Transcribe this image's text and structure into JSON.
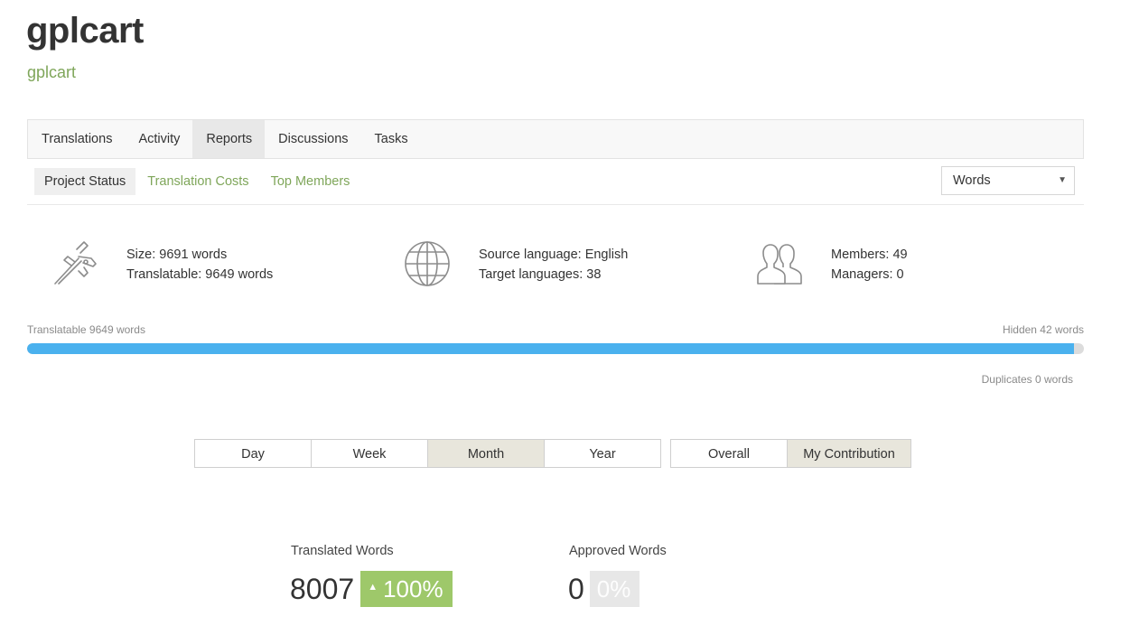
{
  "header": {
    "title": "gplcart",
    "subtitle": "gplcart"
  },
  "main_nav": [
    {
      "label": "Translations",
      "active": false
    },
    {
      "label": "Activity",
      "active": false
    },
    {
      "label": "Reports",
      "active": true
    },
    {
      "label": "Discussions",
      "active": false
    },
    {
      "label": "Tasks",
      "active": false
    }
  ],
  "sub_nav": [
    {
      "label": "Project Status",
      "active": true
    },
    {
      "label": "Translation Costs",
      "active": false
    },
    {
      "label": "Top Members",
      "active": false
    }
  ],
  "unit_select": {
    "value": "Words"
  },
  "stats": {
    "size": {
      "icon": "caliper-icon",
      "line1": "Size: 9691 words",
      "line2": "Translatable: 9649 words"
    },
    "languages": {
      "icon": "globe-icon",
      "line1": "Source language: English",
      "line2": "Target languages: 38"
    },
    "members": {
      "icon": "members-icon",
      "line1": "Members: 49",
      "line2": "Managers: 0"
    }
  },
  "progress": {
    "left_label": "Translatable 9649 words",
    "right_label": "Hidden 42 words",
    "below_label": "Duplicates 0 words",
    "translatable_fraction": 0.9907,
    "fill_color": "#4ab1ee"
  },
  "period_buttons": [
    {
      "label": "Day",
      "active": false
    },
    {
      "label": "Week",
      "active": false
    },
    {
      "label": "Month",
      "active": true
    },
    {
      "label": "Year",
      "active": false
    }
  ],
  "scope_buttons": [
    {
      "label": "Overall",
      "active": false
    },
    {
      "label": "My Contribution",
      "active": true
    }
  ],
  "metrics": {
    "translated": {
      "label": "Translated Words",
      "value": "8007",
      "change": "100%",
      "trend": "up"
    },
    "approved": {
      "label": "Approved Words",
      "value": "0",
      "change": "0%",
      "trend": "none"
    }
  },
  "colors": {
    "accent_green": "#7fa65a",
    "badge_green": "#9ec86a",
    "progress_blue": "#4ab1ee"
  }
}
